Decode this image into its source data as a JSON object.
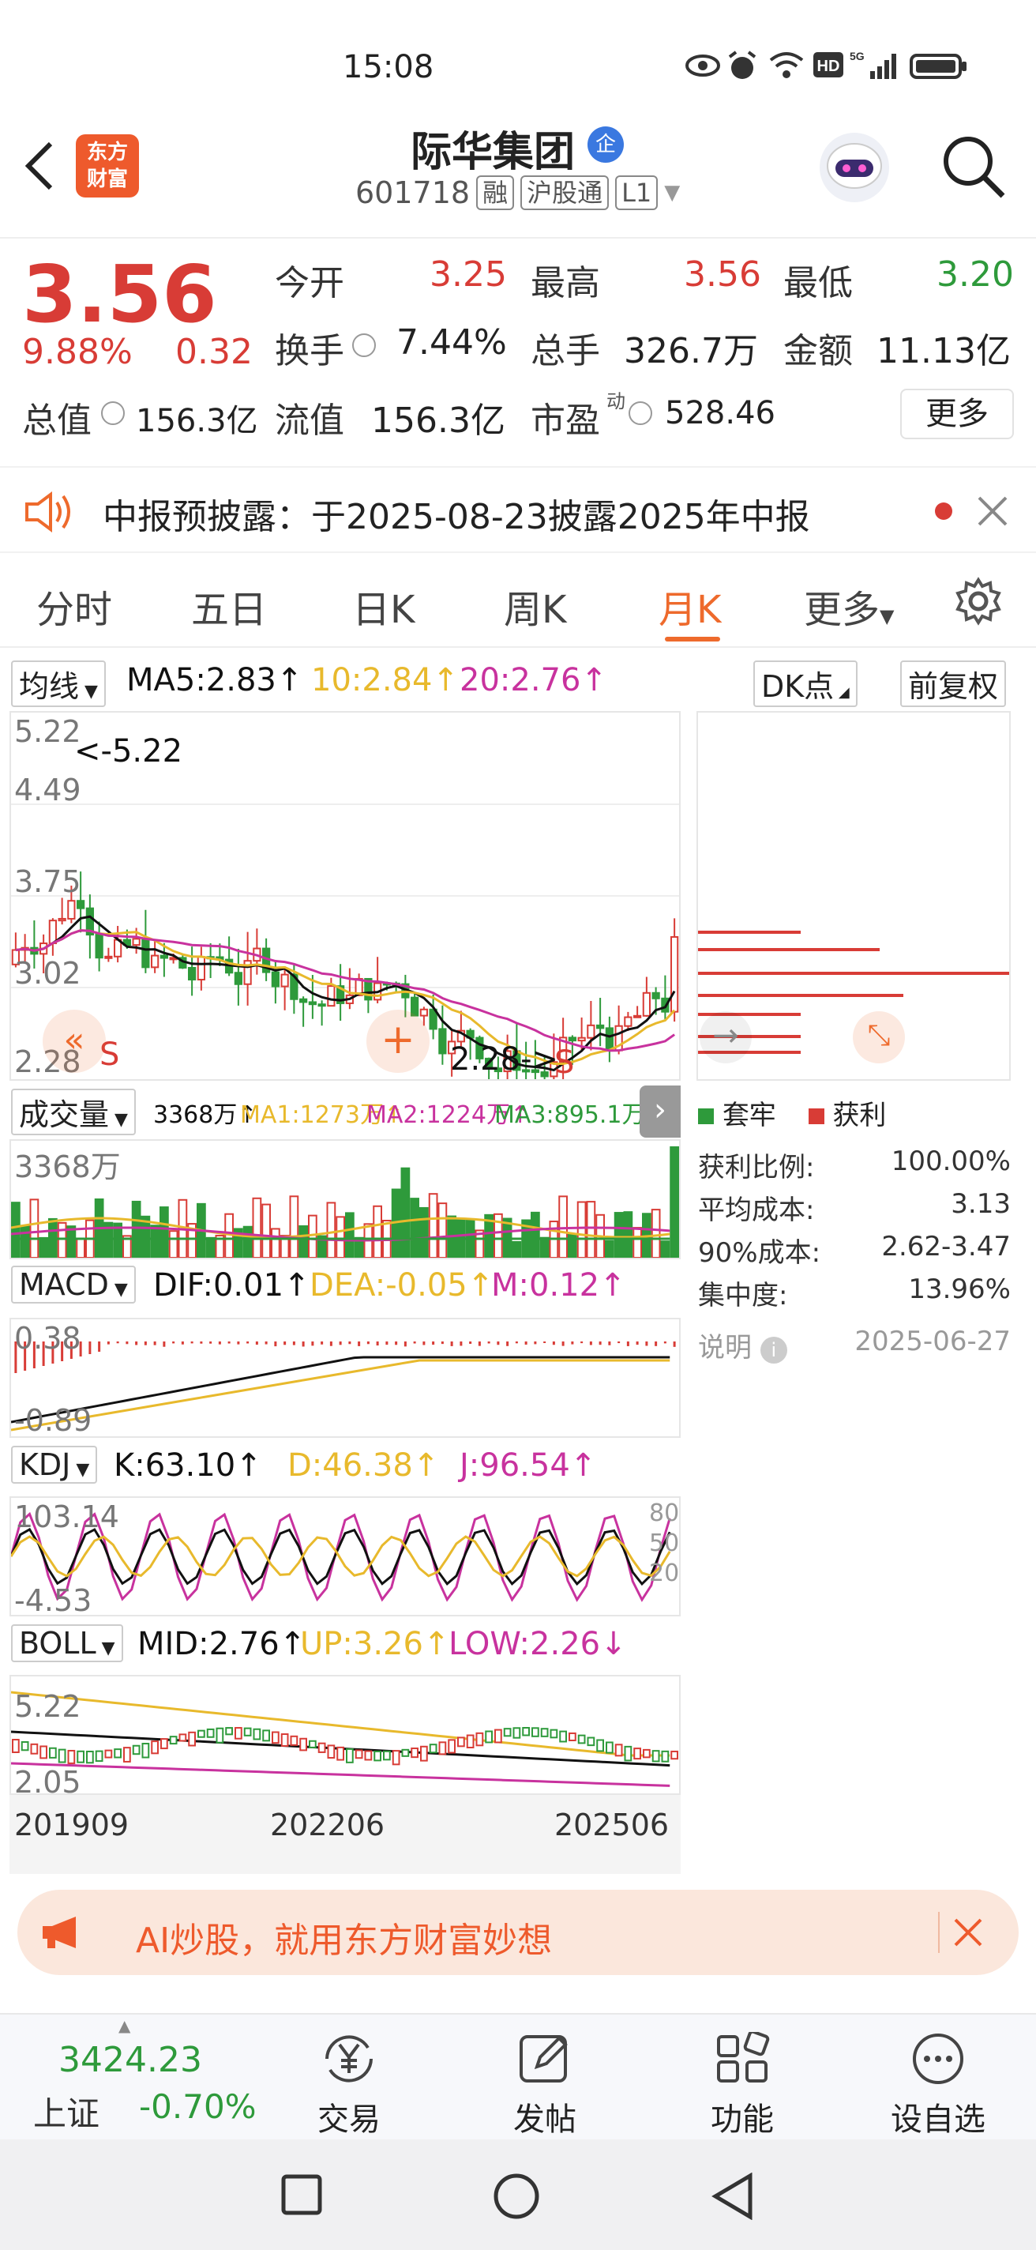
{
  "status": {
    "time": "15:08",
    "icons": [
      "eye-icon",
      "alarm-icon",
      "wifi-icon",
      "hd-icon",
      "signal-5g-icon",
      "battery-icon"
    ]
  },
  "header": {
    "logo_line1": "东方",
    "logo_line2": "财富",
    "name": "际华集团",
    "badge": "企",
    "code": "601718",
    "tags": [
      "融",
      "沪股通",
      "L1"
    ]
  },
  "quote": {
    "price": "3.56",
    "pct": "9.88%",
    "change": "0.32",
    "open_label": "今开",
    "open": "3.25",
    "high_label": "最高",
    "high": "3.56",
    "low_label": "最低",
    "low": "3.20",
    "turnover_label": "换手",
    "turnover": "7.44%",
    "volume_label": "总手",
    "volume": "326.7万",
    "amount_label": "金额",
    "amount": "11.13亿",
    "mktcap_label": "总值",
    "mktcap": "156.3亿",
    "float_label": "流值",
    "float": "156.3亿",
    "pe_label": "市盈",
    "pe_sup": "动",
    "pe": "528.46",
    "more": "更多"
  },
  "notice": {
    "text": "中报预披露：于2025-08-23披露2025年中报"
  },
  "tabs": [
    "分时",
    "五日",
    "日K",
    "周K",
    "月K",
    "更多"
  ],
  "active_tab": "月K",
  "kline": {
    "selector": "均线",
    "ma5": "MA5:2.83↑",
    "ma10": "10:2.84↑",
    "ma20": "20:2.76↑",
    "dk": "DK点",
    "fq": "前复权",
    "y_labels": [
      "5.22",
      "4.49",
      "3.75",
      "3.02",
      "2.28"
    ],
    "high_mark": "<-5.22",
    "low_mark": "2.28->",
    "s_mark": "S",
    "colors": {
      "up": "#d83c36",
      "down": "#2e9a3b",
      "ma5": "#111111",
      "ma10": "#e8b92c",
      "ma20": "#c8329e"
    }
  },
  "volume": {
    "selector": "成交量",
    "value": "3368万↑",
    "ma1": "MA1:1273万↑",
    "ma2": "MA2:1224万↑",
    "ma3": "MA3:895.1万↑",
    "y_label": "3368万"
  },
  "macd": {
    "selector": "MACD",
    "dif": "DIF:0.01↑",
    "dea": "DEA:-0.05↑",
    "m": "M:0.12↑",
    "y_top": "0.38",
    "y_bottom": "-0.89"
  },
  "kdj": {
    "selector": "KDJ",
    "k": "K:63.10↑",
    "d": "D:46.38↑",
    "j": "J:96.54↑",
    "y_top": "103.14",
    "y_bottom": "-4.53",
    "levels": [
      "80",
      "50",
      "20"
    ]
  },
  "boll": {
    "selector": "BOLL",
    "mid": "MID:2.76↑",
    "up": "UP:3.26↑",
    "low": "LOW:2.26↓",
    "y_top": "5.22",
    "y_bottom": "2.05",
    "x_labels": [
      "201909",
      "202206",
      "202506"
    ]
  },
  "chips": {
    "legend_trapped": "套牢",
    "legend_profit": "获利",
    "rows": [
      {
        "label": "获利比例:",
        "value": "100.00%"
      },
      {
        "label": "平均成本:",
        "value": "3.13"
      },
      {
        "label": "90%成本:",
        "value": "2.62-3.47"
      },
      {
        "label": "集中度:",
        "value": "13.96%"
      }
    ],
    "note_label": "说明",
    "date": "2025-06-27"
  },
  "ad": {
    "text": "AI炒股，就用东方财富妙想"
  },
  "bottomnav": {
    "index_value": "3424.23",
    "index_name": "上证",
    "index_change": "-0.70%",
    "items": [
      "交易",
      "发帖",
      "功能",
      "设自选"
    ]
  }
}
